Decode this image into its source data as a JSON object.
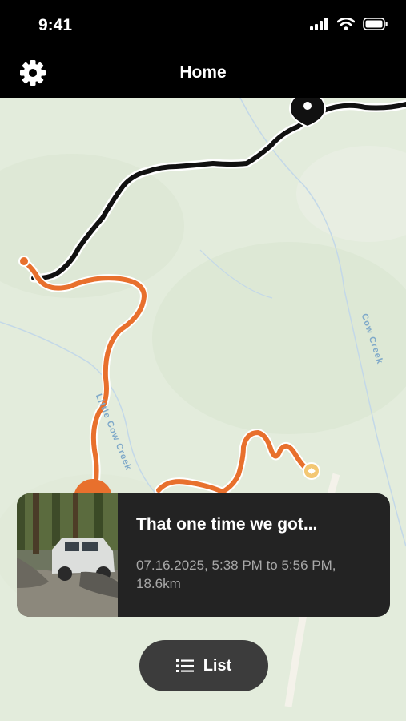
{
  "status_bar": {
    "time": "9:41",
    "icons": [
      "signal-icon",
      "wifi-icon",
      "battery-icon"
    ]
  },
  "nav": {
    "title": "Home",
    "left_icon": "gear-icon"
  },
  "map": {
    "labels": {
      "little_cow_creek": "Little Cow Creek",
      "cow_creek": "Cow Creek"
    },
    "colors": {
      "land": "#e3ecdc",
      "route_active": "#e8702d",
      "route_other": "#111111",
      "water": "#b9d3e6"
    }
  },
  "trip_card": {
    "title": "That one time we got...",
    "subtitle": "07.16.2025, 5:38 PM to 5:56 PM, 18.6km"
  },
  "list_button": {
    "label": "List",
    "icon": "list-icon"
  }
}
